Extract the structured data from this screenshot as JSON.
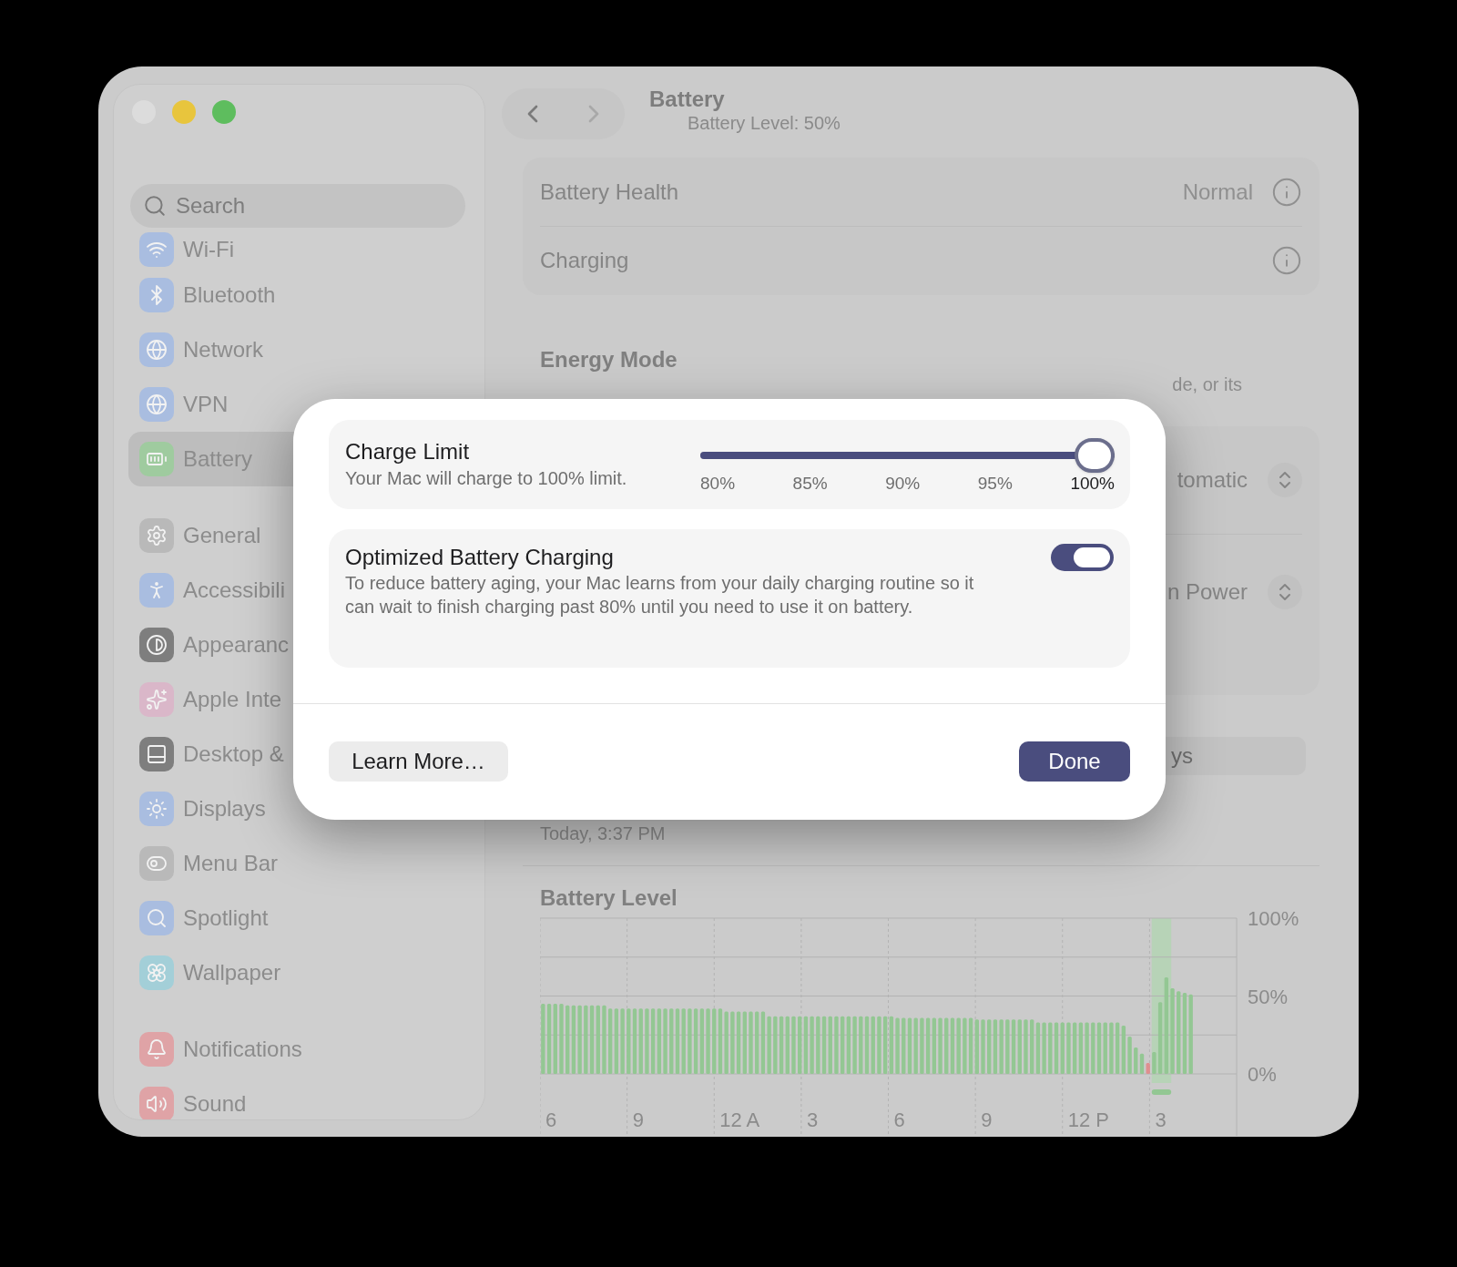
{
  "window": {
    "title": "Battery",
    "subtitle": "Battery Level: 50%"
  },
  "sidebar": {
    "search": {
      "placeholder": "Search"
    },
    "groups": [
      {
        "items": [
          {
            "label": "Wi-Fi",
            "selected": false,
            "color": "#a9bde0"
          },
          {
            "label": "Bluetooth",
            "selected": false,
            "color": "#a9bde0"
          },
          {
            "label": "Network",
            "selected": false,
            "color": "#a9bde0"
          },
          {
            "label": "VPN",
            "selected": false,
            "color": "#a9bde0"
          },
          {
            "label": "Battery",
            "selected": true,
            "color": "#9fcb9f"
          }
        ]
      },
      {
        "items": [
          {
            "label": "General",
            "selected": false,
            "color": "#b9b9b9"
          },
          {
            "label": "Accessibili",
            "selected": false,
            "color": "#a9bde0"
          },
          {
            "label": "Appearanc",
            "selected": false,
            "color": "#7e7e7e"
          },
          {
            "label": "Apple Inte",
            "selected": false,
            "color": "#dab7c9"
          },
          {
            "label": "Desktop &",
            "selected": false,
            "color": "#7e7e7e"
          },
          {
            "label": "Displays",
            "selected": false,
            "color": "#a9bde0"
          },
          {
            "label": "Menu Bar",
            "selected": false,
            "color": "#b9b9b9"
          },
          {
            "label": "Spotlight",
            "selected": false,
            "color": "#a9bde0"
          },
          {
            "label": "Wallpaper",
            "selected": false,
            "color": "#a3cfd8"
          }
        ]
      },
      {
        "items": [
          {
            "label": "Notifications",
            "selected": false,
            "color": "#dfa3a6"
          },
          {
            "label": "Sound",
            "selected": false,
            "color": "#dfa3a6"
          }
        ]
      }
    ]
  },
  "health": [
    {
      "label": "Battery Health",
      "value": "Normal"
    },
    {
      "label": "Charging"
    }
  ],
  "energy_mode": {
    "title": "Energy Mode",
    "description": "de, or its",
    "rows": [
      {
        "value": "tomatic"
      },
      {
        "value": "n Power"
      }
    ]
  },
  "options_button": "ys",
  "last_charged": "Today, 3:37 PM",
  "battery_level": {
    "title": "Battery Level",
    "x_labels": [
      "6",
      "9",
      "12 A",
      "3",
      "6",
      "9",
      "12 P",
      "3"
    ],
    "chart_data": {
      "type": "bar",
      "stacked": true,
      "ylim": [
        0,
        100
      ],
      "yticks": [
        {
          "value": 0,
          "label": "0%"
        },
        {
          "value": 50,
          "label": "50%"
        },
        {
          "value": 100,
          "label": "100%"
        }
      ],
      "series": [
        {
          "color": "#93c793",
          "values": [
            45,
            45,
            45,
            45,
            44,
            44,
            44,
            44,
            44,
            44,
            44,
            42,
            42,
            42,
            42,
            42,
            42,
            42,
            42,
            42,
            42,
            42,
            42,
            42,
            42,
            42,
            42,
            42,
            42,
            42,
            40,
            40,
            40,
            40,
            40,
            40,
            40,
            37,
            37,
            37,
            37,
            37,
            37,
            37,
            37,
            37,
            37,
            37,
            37,
            37,
            37,
            37,
            37,
            37,
            37,
            37,
            37,
            37,
            36,
            36,
            36,
            36,
            36,
            36,
            36,
            36,
            36,
            36,
            36,
            36,
            36,
            35,
            35,
            35,
            35,
            35,
            35,
            35,
            35,
            35,
            35,
            33,
            33,
            33,
            33,
            33,
            33,
            33,
            33,
            33,
            33,
            33,
            33,
            33,
            33,
            31,
            24,
            17,
            13,
            null,
            14,
            46,
            62,
            55,
            53,
            52,
            51
          ]
        },
        {
          "color": "#df8f8f",
          "values": [
            null,
            null,
            null,
            null,
            null,
            null,
            null,
            null,
            null,
            null,
            null,
            null,
            null,
            null,
            null,
            null,
            null,
            null,
            null,
            null,
            null,
            null,
            null,
            null,
            null,
            null,
            null,
            null,
            null,
            null,
            null,
            null,
            null,
            null,
            null,
            null,
            null,
            null,
            null,
            null,
            null,
            null,
            null,
            null,
            null,
            null,
            null,
            null,
            null,
            null,
            null,
            null,
            null,
            null,
            null,
            null,
            null,
            null,
            null,
            null,
            null,
            null,
            null,
            null,
            null,
            null,
            null,
            null,
            null,
            null,
            null,
            null,
            null,
            null,
            null,
            null,
            null,
            null,
            null,
            null,
            null,
            null,
            null,
            null,
            null,
            null,
            null,
            null,
            null,
            null,
            null,
            null,
            null,
            null,
            null,
            null,
            null,
            null,
            null,
            7,
            null,
            null,
            null,
            null,
            null,
            null,
            null
          ]
        }
      ]
    }
  },
  "dialog": {
    "charge_limit": {
      "title": "Charge Limit",
      "description": "Your Mac will charge to 100% limit.",
      "level": 1,
      "ticks": [
        {
          "label": "80%",
          "selected": false
        },
        {
          "label": "85%",
          "selected": false
        },
        {
          "label": "90%",
          "selected": false
        },
        {
          "label": "95%",
          "selected": false
        },
        {
          "label": "100%",
          "selected": true
        }
      ]
    },
    "optimized": {
      "title": "Optimized Battery Charging",
      "description": "To reduce battery aging, your Mac learns from your daily charging routine so it can wait to finish charging past 80% until you need to use it on battery.",
      "on": true
    },
    "buttons": [
      {
        "label": "Learn More…",
        "kind": "secondary"
      },
      {
        "label": "Done",
        "kind": "primary"
      }
    ]
  }
}
